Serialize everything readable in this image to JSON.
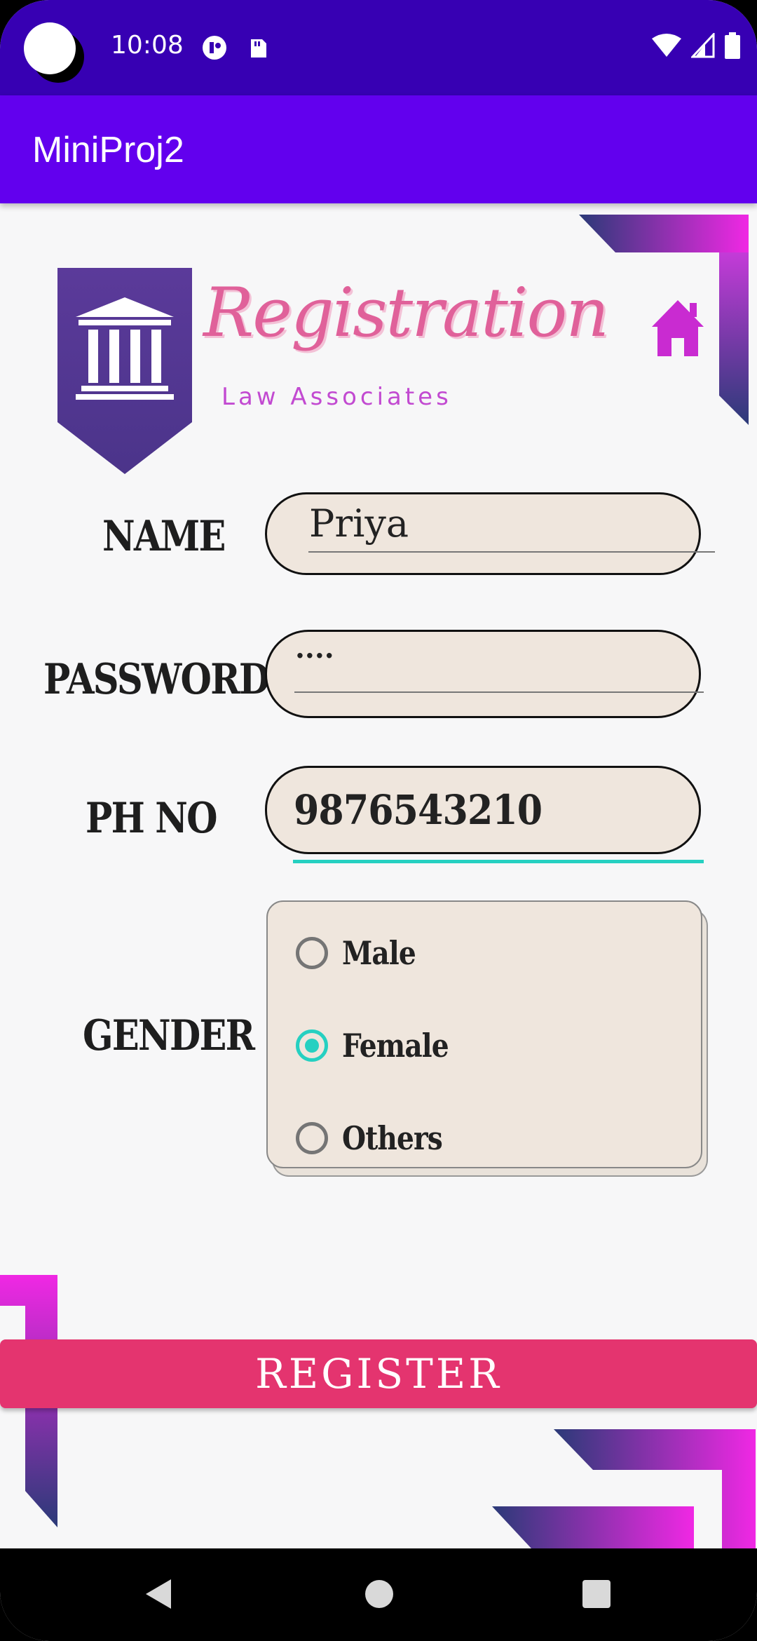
{
  "status_bar": {
    "time": "10:08",
    "icons": [
      "camera-cutout",
      "data-saver-icon",
      "sd-card-icon",
      "wifi-icon",
      "signal-icon",
      "battery-icon"
    ]
  },
  "app_bar": {
    "title": "MiniProj2"
  },
  "header": {
    "title": "Registration",
    "subtitle": "Law Associates",
    "logo_icon": "courthouse-icon",
    "home_icon": "home-icon"
  },
  "form": {
    "name": {
      "label": "NAME",
      "value": "Priya"
    },
    "password": {
      "label": "PASSWORD",
      "value": "...."
    },
    "phone": {
      "label": "PH NO",
      "value": "9876543210"
    },
    "gender": {
      "label": "GENDER",
      "options": [
        "Male",
        "Female",
        "Others"
      ],
      "selected": "Female"
    }
  },
  "register_button": {
    "label": "REGISTER"
  },
  "colors": {
    "status_bar": "#3700b3",
    "app_bar": "#6200ee",
    "accent": "#26d0c1",
    "register": "#e4346f",
    "title_pink": "#e0619a",
    "logo_purple": "#5b3a9a",
    "home_magenta": "#c92bd1"
  },
  "navigation": {
    "icons": [
      "back-icon",
      "home-circle-icon",
      "recents-icon"
    ]
  }
}
